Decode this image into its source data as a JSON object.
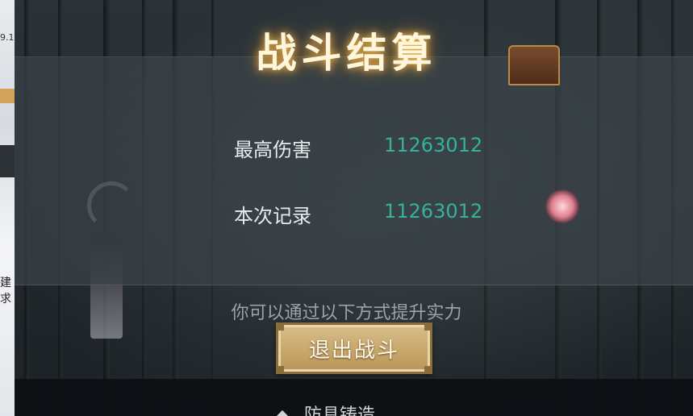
{
  "left_strip": {
    "text_top": "9.1",
    "text_mid": "建求"
  },
  "title": "战斗结算",
  "stats": {
    "max_damage_label": "最高伤害",
    "max_damage_value": "11263012",
    "this_record_label": "本次记录",
    "this_record_value": "11263012"
  },
  "hint": "你可以通过以下方式提升实力",
  "exit_button": "退出战斗",
  "bottom_item": "防具铸造",
  "colors": {
    "accent_value": "#34b39a",
    "title_glow": "#ffbe50",
    "button_gold": "#c9a96e"
  }
}
